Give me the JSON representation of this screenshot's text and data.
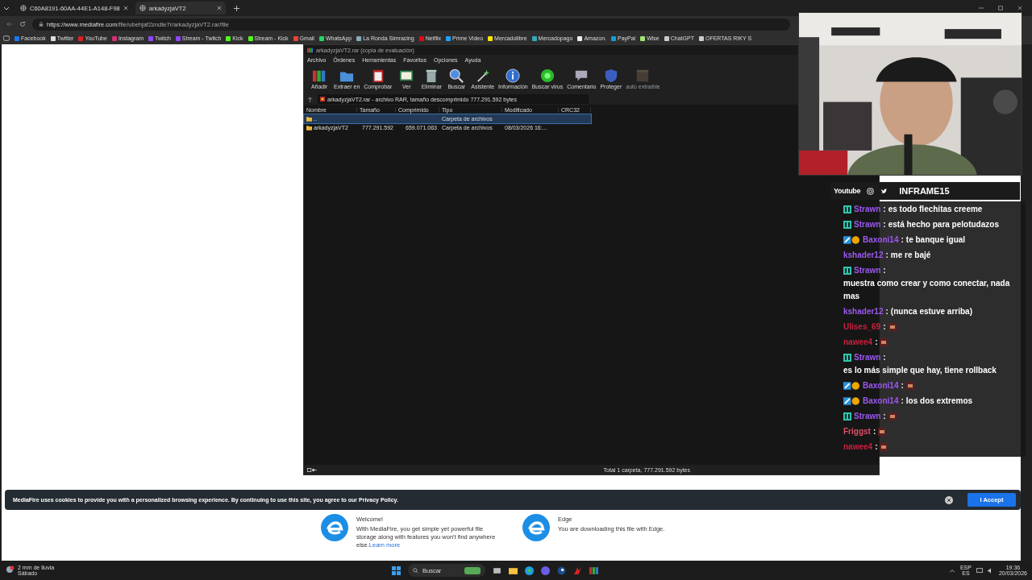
{
  "browser": {
    "tabs": [
      {
        "title": "C60A8191-60AA-44E1-A148-F98",
        "selected": false
      },
      {
        "title": "arkadyzjaVT2",
        "selected": true
      }
    ],
    "url": {
      "host": "https://www.mediafire.com",
      "path": "/file/ubehjaf2zndte7r/arkadyzjaVT2.rar/file"
    },
    "bookmarks": [
      "Facebook",
      "Twitter",
      "YouTube",
      "Instagram",
      "Twitch",
      "Stream - Twitch",
      "Kick",
      "Stream - Kick",
      "Gmail",
      "WhatsApp",
      "La Ronda Simracing",
      "Netflix",
      "Prime Video",
      "Mercadolibre",
      "Mercadopago",
      "Amazon.",
      "PayPal",
      "Wise",
      "ChatGPT",
      "OFERTAS RIKY S"
    ]
  },
  "page": {
    "cards": [
      {
        "title": "Welcome!",
        "text": "With MediaFire, you get simple yet powerful file storage along with features you won't find anywhere else.",
        "link": "Learn more"
      },
      {
        "title": "Edge",
        "text": "You are downloading this file with Edge."
      }
    ],
    "cookie_banner": {
      "text": "MediaFire uses cookies to provide you with a personalized browsing experience. By continuing to use this site, you agree to our Privacy Policy.",
      "button": "I Accept"
    }
  },
  "winrar": {
    "title": "arkadyzjaVT2.rar (copia de evaluación)",
    "menu": [
      "Archivo",
      "Órdenes",
      "Herramientas",
      "Favoritos",
      "Opciones",
      "Ayuda"
    ],
    "toolbar": [
      {
        "label": "Añadir",
        "disabled": false
      },
      {
        "label": "Extraer en",
        "disabled": false
      },
      {
        "label": "Comprobar",
        "disabled": false
      },
      {
        "label": "Ver",
        "disabled": false
      },
      {
        "label": "Eliminar",
        "disabled": false
      },
      {
        "label": "Buscar",
        "disabled": false
      },
      {
        "label": "Asistente",
        "disabled": false
      },
      {
        "label": "Información",
        "disabled": false
      },
      {
        "label": "Buscar virus",
        "disabled": false
      },
      {
        "label": "Comentario",
        "disabled": false
      },
      {
        "label": "Proteger",
        "disabled": false
      },
      {
        "label": "auto extraíble",
        "disabled": true
      }
    ],
    "path": "arkadyzjaVT2.rar - archivo RAR, tamaño descomprimido 777.291.592 bytes",
    "columns": [
      "Nombre",
      "Tamaño",
      "Comprimido",
      "Tipo",
      "Modificado",
      "CRC32"
    ],
    "rows": [
      {
        "cells": [
          "..",
          "",
          "",
          "Carpeta de archivos",
          "",
          ""
        ],
        "selected": true
      },
      {
        "cells": [
          "arkadyzjaVT2",
          "777.291.592",
          "659.071.063",
          "Carpeta de archivos",
          "08/03/2026 16:...",
          ""
        ],
        "selected": false
      }
    ],
    "status": "Total 1 carpeta, 777.291.592 bytes"
  },
  "stream": {
    "socials": "Youtube",
    "channel": "INFRAME15",
    "chat": [
      {
        "user": "Strawn",
        "color": "#9b59f0",
        "gg_badge": true,
        "sub_badge": false,
        "sep": ":",
        "kind": "text",
        "text": "es todo flechitas creeme"
      },
      {
        "user": "Strawn",
        "color": "#9b59f0",
        "gg_badge": true,
        "sub_badge": false,
        "sep": ":",
        "kind": "text",
        "text": "está hecho para pelotudazos"
      },
      {
        "user": "Baxoni14",
        "color": "#9b59f0",
        "gg_badge": false,
        "sub_badge": true,
        "sep": ":",
        "kind": "text",
        "text": "te banque igual"
      },
      {
        "user": "kshader12",
        "color": "#9b59f0",
        "gg_badge": false,
        "sub_badge": false,
        "sep": ":",
        "kind": "text",
        "text": "me re bajé"
      },
      {
        "user": "Strawn",
        "color": "#9b59f0",
        "gg_badge": true,
        "sub_badge": false,
        "sep": ":",
        "kind": "text",
        "text": "muestra como crear y como conectar, nada mas"
      },
      {
        "user": "kshader12",
        "color": "#9b59f0",
        "gg_badge": false,
        "sub_badge": false,
        "sep": ":",
        "kind": "text",
        "text": "(nunca estuve arriba)"
      },
      {
        "user": "Ulises_69",
        "color": "#c8203c",
        "gg_badge": false,
        "sub_badge": false,
        "sep": ":",
        "kind": "emote"
      },
      {
        "user": "nawee4",
        "color": "#c8203c",
        "gg_badge": false,
        "sub_badge": false,
        "sep": ":",
        "kind": "emote"
      },
      {
        "user": "Strawn",
        "color": "#9b59f0",
        "gg_badge": true,
        "sub_badge": false,
        "sep": ":",
        "kind": "text",
        "text": "es lo más simple que hay, tiene rollback"
      },
      {
        "user": "Baxoni14",
        "color": "#9b59f0",
        "gg_badge": false,
        "sub_badge": true,
        "sep": ":",
        "kind": "emote"
      },
      {
        "user": "Baxoni14",
        "color": "#9b59f0",
        "gg_badge": false,
        "sub_badge": true,
        "sep": ":",
        "kind": "text",
        "text": "los dos extremos"
      },
      {
        "user": "Strawn",
        "color": "#9b59f0",
        "gg_badge": true,
        "sub_badge": false,
        "sep": ":",
        "kind": "emote"
      },
      {
        "user": "Friggst",
        "color": "#e0506a",
        "gg_badge": false,
        "sub_badge": false,
        "sep": ":",
        "kind": "emote"
      },
      {
        "user": "nawee4",
        "color": "#c8203c",
        "gg_badge": false,
        "sub_badge": false,
        "sep": ":",
        "kind": "emote"
      }
    ]
  },
  "taskbar": {
    "weather": "2 mm de lluvia",
    "day": "Sábado",
    "search": "Buscar",
    "lang": "ESP",
    "region": "ES",
    "time": "19:36",
    "date": "20/03/2026"
  }
}
